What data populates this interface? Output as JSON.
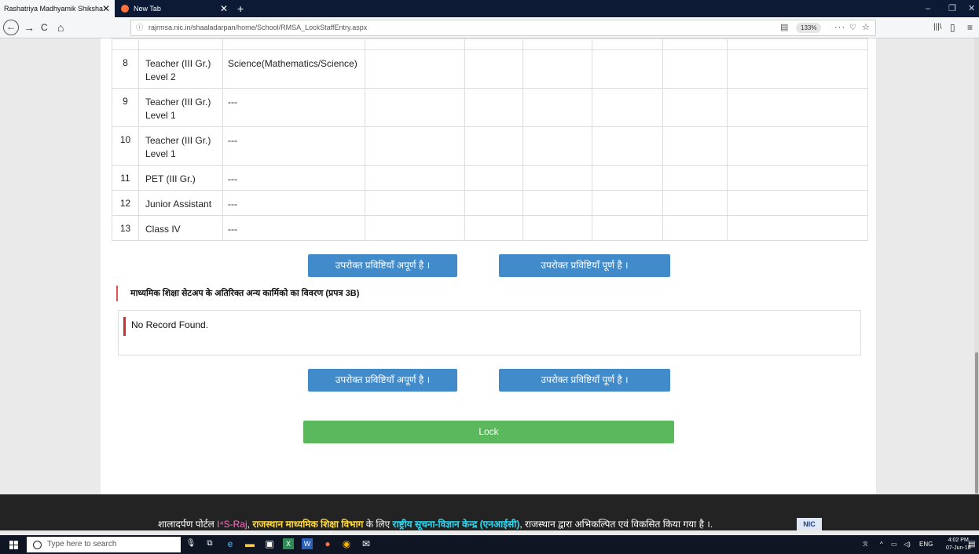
{
  "browser": {
    "tabs": [
      {
        "title": "Rashatriya Madhyamik Shiksha Abl",
        "close": "✕"
      },
      {
        "title": "New Tab",
        "close": "✕"
      }
    ],
    "new_tab": "+",
    "window_controls": {
      "minimize": "–",
      "maximize": "❐",
      "close": "✕"
    },
    "nav": {
      "back": "←",
      "forward": "→",
      "reload": "C",
      "home": "⌂"
    },
    "url": "rajrmsa.nic.in/shaaladarpan/home/School/RMSA_LockStaffEntry.aspx",
    "url_info": "ⓘ",
    "reader": "▤",
    "zoom": "133%",
    "more": "···",
    "pocket": "♡",
    "star": "☆",
    "library": "|||\\",
    "sidebar": "▯",
    "menu": "≡"
  },
  "staff_table": {
    "rows": [
      {
        "num": "8",
        "post": "Teacher (III Gr.) Level 2",
        "subject": "Science(Mathematics/Science)"
      },
      {
        "num": "9",
        "post": "Teacher (III Gr.) Level 1",
        "subject": "---"
      },
      {
        "num": "10",
        "post": "Teacher (III Gr.) Level 1",
        "subject": "---"
      },
      {
        "num": "11",
        "post": "PET (III Gr.)",
        "subject": "---"
      },
      {
        "num": "12",
        "post": "Junior Assistant",
        "subject": "---"
      },
      {
        "num": "13",
        "post": "Class IV",
        "subject": "---"
      }
    ]
  },
  "buttons": {
    "incomplete": "उपरोक्त प्रविष्टियाँ अपूर्ण है ।",
    "complete": "उपरोक्त प्रविष्टियाँ पूर्ण है ।",
    "lock": "Lock"
  },
  "section_3b": {
    "heading": "माध्यमिक शिक्षा सेटअप के अतिरिक्त अन्य कार्मिको का विवरण (प्रपत्र 3B)",
    "empty_message": "No Record Found."
  },
  "footer": {
    "part1": "शालादर्पण पोर्टल ",
    "brand": "I⁴S-Raj",
    "part2": ", ",
    "dept": "राजस्थान माध्यमिक शिक्षा विभाग",
    "part3": " के लिए ",
    "nic": "राष्ट्रीय सूचना-विज्ञान केन्द्र (एनआईसी)",
    "part4": ", राजस्थान  द्वारा अभिकल्पित एवं  विकसित किया गया है ।.",
    "logo": "NIC"
  },
  "taskbar": {
    "search_placeholder": "Type here to search",
    "tray_lang": "ENG",
    "time": "4:02 PM",
    "date": "07-Jun-18"
  }
}
